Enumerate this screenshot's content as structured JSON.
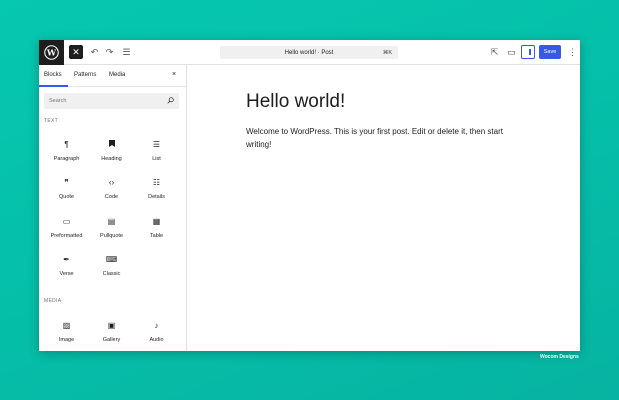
{
  "topbar": {
    "logo_icon": "wordpress-logo",
    "command_label": "Hello world! · Post",
    "command_shortcut": "⌘K",
    "save_label": "Save"
  },
  "inserter": {
    "tabs": [
      {
        "label": "Blocks",
        "active": true
      },
      {
        "label": "Patterns",
        "active": false
      },
      {
        "label": "Media",
        "active": false
      }
    ],
    "close": "×",
    "search_placeholder": "Search",
    "categories": {
      "text": "TEXT",
      "media": "MEDIA"
    },
    "text_blocks": [
      {
        "label": "Paragraph",
        "icon": "¶"
      },
      {
        "label": "Heading",
        "icon": "🔖"
      },
      {
        "label": "List",
        "icon": "☰"
      },
      {
        "label": "Quote",
        "icon": "❞"
      },
      {
        "label": "Code",
        "icon": "‹›"
      },
      {
        "label": "Details",
        "icon": "☷"
      },
      {
        "label": "Preformatted",
        "icon": "▭"
      },
      {
        "label": "Pullquote",
        "icon": "▤"
      },
      {
        "label": "Table",
        "icon": "▦"
      },
      {
        "label": "Verse",
        "icon": "✒"
      },
      {
        "label": "Classic",
        "icon": "⌨"
      }
    ],
    "media_blocks": [
      {
        "label": "Image",
        "icon": "▨"
      },
      {
        "label": "Gallery",
        "icon": "▣"
      },
      {
        "label": "Audio",
        "icon": "♪"
      }
    ]
  },
  "post": {
    "title": "Hello world!",
    "body": "Welcome to WordPress. This is your first post. Edit or delete it, then start writing!"
  },
  "credit": "Wocom Designs",
  "colors": {
    "accent": "#3858e9",
    "background": "#06c7b0"
  }
}
